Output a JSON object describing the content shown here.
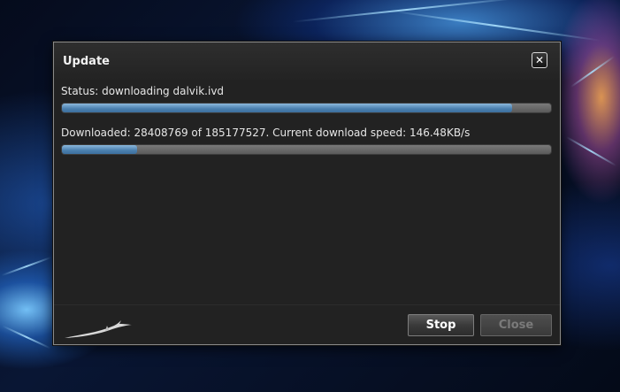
{
  "dialog": {
    "title": "Update",
    "close_icon": "close-x-icon",
    "status_text": "Status: downloading dalvik.ivd",
    "status_progress_percent": 92,
    "download_text": "Downloaded: 28408769 of 185177527. Current download speed: 146.48KB/s",
    "download_progress_percent": 15.3,
    "logo_icon": "brand-logo-icon",
    "buttons": {
      "stop_label": "Stop",
      "close_label": "Close"
    }
  },
  "colors": {
    "progress_fill": "#4a7fae",
    "dialog_bg": "#222222"
  }
}
